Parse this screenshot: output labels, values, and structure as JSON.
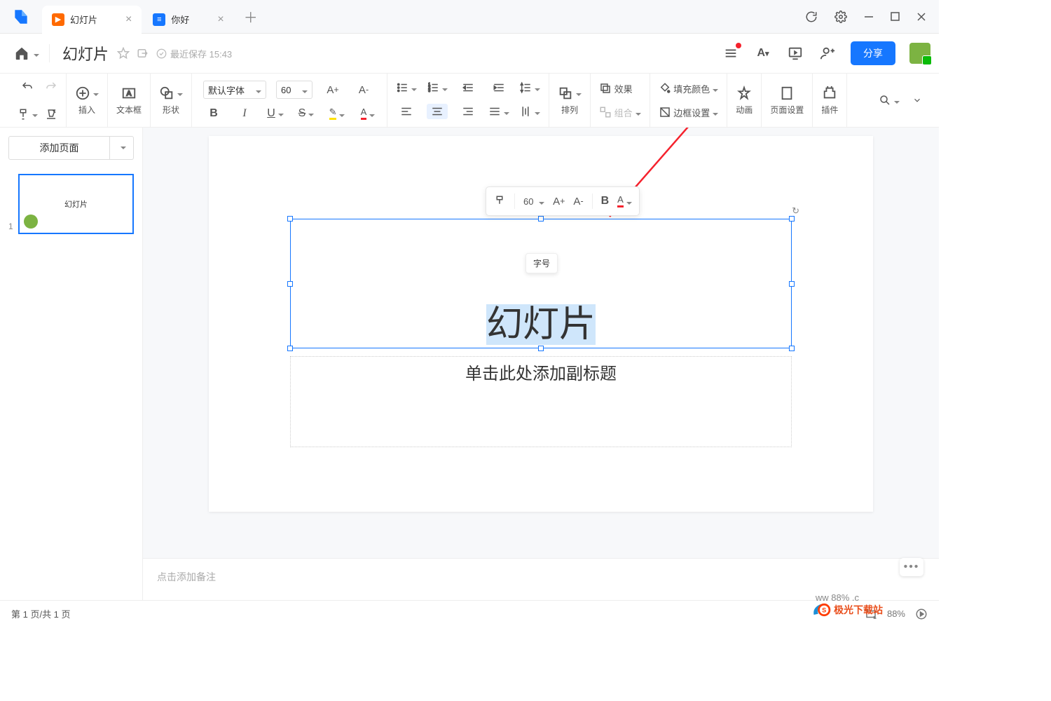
{
  "titlebar": {
    "tabs": [
      {
        "title": "幻灯片",
        "icon_bg": "#ff6a00"
      },
      {
        "title": "你好",
        "icon_bg": "#1677ff"
      }
    ]
  },
  "header": {
    "doc_title": "幻灯片",
    "saved_label": "最近保存 15:43",
    "share": "分享"
  },
  "toolbar": {
    "insert": "插入",
    "textbox": "文本框",
    "shapes": "形状",
    "font_name": "默认字体",
    "font_size": "60",
    "arrange": "排列",
    "effect": "效果",
    "group": "组合",
    "fill": "填充颜色",
    "border": "边框设置",
    "animation": "动画",
    "page_setup": "页面设置",
    "plugins": "插件"
  },
  "sidebar": {
    "add_page": "添加页面",
    "thumb_index": "1",
    "thumb_title": "幻灯片"
  },
  "slide": {
    "title": "幻灯片",
    "subtitle_placeholder": "单击此处添加副标题"
  },
  "float_toolbar": {
    "size": "60",
    "tooltip": "字号"
  },
  "notes": {
    "placeholder": "点击添加备注"
  },
  "statusbar": {
    "page_info": "第 1 页/共 1 页",
    "zoom": "88%"
  },
  "watermark": "极光下载站"
}
